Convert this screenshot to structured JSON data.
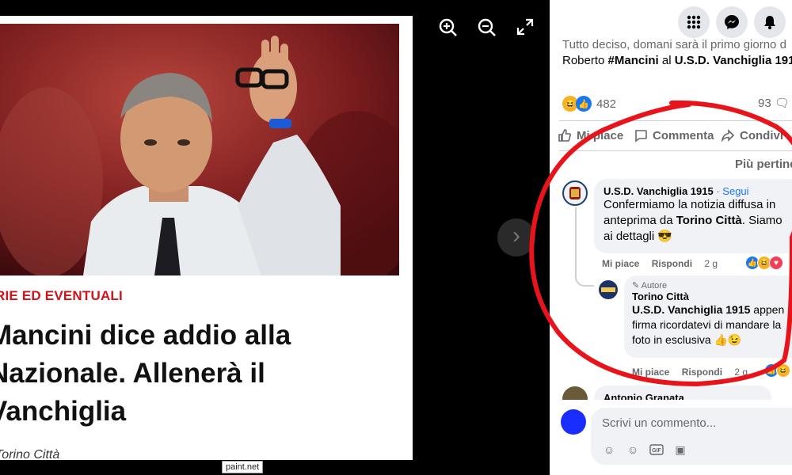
{
  "viewer": {
    "article": {
      "kicker": "RIE ED EVENTUALI",
      "headline_lines": [
        "Mancini dice addio alla",
        "Nazionale. Allenerà il",
        "Vanchiglia"
      ],
      "byline": "Torino Città"
    },
    "controls": {
      "zoom_in_icon": "zoom-in-icon",
      "zoom_out_icon": "zoom-out-icon",
      "fullscreen_icon": "fullscreen-icon",
      "next_icon": "chevron-right-icon"
    },
    "watermark": "paint.net"
  },
  "panel": {
    "post": {
      "line1": "Tutto deciso, domani sarà il primo giorno d",
      "line2_prefix": "Roberto ",
      "line2_hashtag": "#Mancini",
      "line2_mid": " al ",
      "line2_bold": "U.S.D. Vanchiglia 1915"
    },
    "reactions": {
      "count": "482",
      "comments": "93"
    },
    "actions": {
      "like": "Mi piace",
      "comment": "Commenta",
      "share": "Condivi"
    },
    "sort_label": "Più pertine",
    "comments": [
      {
        "author": "U.S.D. Vanchiglia 1915",
        "follow": " · Segui",
        "text_part1": "Confermiamo la notizia diffusa in anteprima da ",
        "text_bold": "Torino Città",
        "text_part2": ". Siamo ai dettagli 😎",
        "like": "Mi piace",
        "reply": "Rispondi",
        "time": "2 g"
      },
      {
        "badge": "Autore",
        "author": "Torino Città",
        "text_bold": "U.S.D. Vanchiglia 1915",
        "text_part2": " appen firma ricordatevi di mandare la foto in esclusiva 👍😉",
        "like": "Mi piace",
        "reply": "Rispondi",
        "time": "2 g"
      },
      {
        "author": "Antonio Granata"
      }
    ],
    "composer": {
      "placeholder": "Scrivi un commento..."
    }
  },
  "colors": {
    "accent": "#1877f2",
    "annotation": "#e8141b",
    "kicker": "#d0121b"
  }
}
